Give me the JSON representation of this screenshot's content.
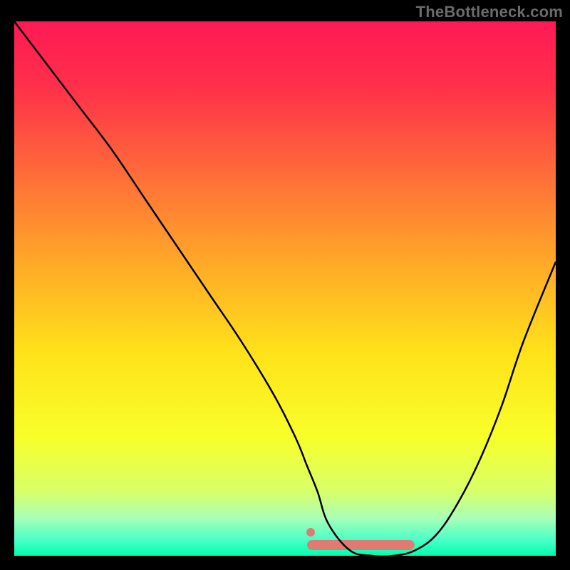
{
  "watermark": "TheBottleneck.com",
  "chart_data": {
    "type": "line",
    "title": "",
    "xlabel": "",
    "ylabel": "",
    "xlim": [
      0,
      100
    ],
    "ylim": [
      0,
      100
    ],
    "grid": false,
    "legend": false,
    "series": [
      {
        "name": "curve",
        "color": "#000000",
        "x": [
          0,
          6,
          12,
          18,
          24,
          30,
          36,
          42,
          48,
          52,
          54,
          56,
          58,
          62,
          66,
          70,
          74,
          78,
          82,
          86,
          90,
          94,
          100
        ],
        "y": [
          100,
          92,
          84,
          76,
          67,
          58,
          49,
          40,
          30,
          22,
          17,
          12,
          6,
          1,
          0,
          0,
          1,
          4,
          10,
          18,
          28,
          40,
          55
        ]
      }
    ],
    "highlight_band": {
      "name": "optimal-zone",
      "color": "#e17a73",
      "x_start": 55,
      "x_end": 73,
      "y": 2
    },
    "gradient_stops": [
      {
        "offset": 0.0,
        "color": "#ff1a55"
      },
      {
        "offset": 0.12,
        "color": "#ff2f4a"
      },
      {
        "offset": 0.28,
        "color": "#ff6a3a"
      },
      {
        "offset": 0.45,
        "color": "#ffa828"
      },
      {
        "offset": 0.62,
        "color": "#ffe21a"
      },
      {
        "offset": 0.78,
        "color": "#f8ff2a"
      },
      {
        "offset": 0.88,
        "color": "#d8ff6a"
      },
      {
        "offset": 0.93,
        "color": "#a8ffb8"
      },
      {
        "offset": 0.97,
        "color": "#4affc8"
      },
      {
        "offset": 1.0,
        "color": "#00ffb0"
      }
    ]
  }
}
